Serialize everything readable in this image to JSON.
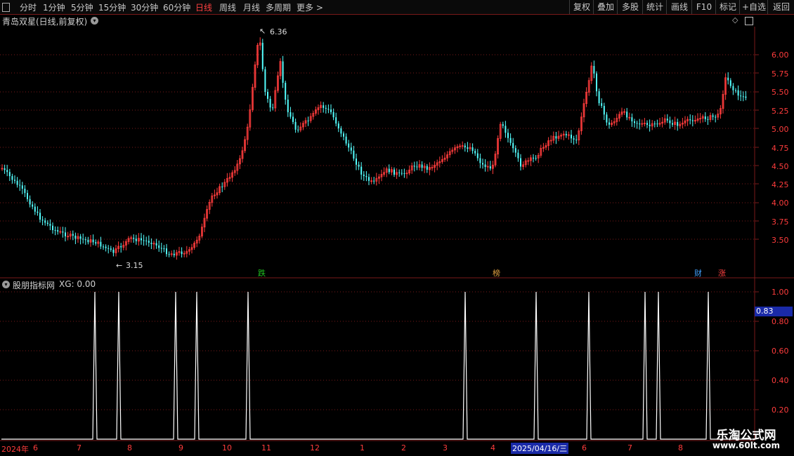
{
  "toolbar": {
    "left_items": [
      "分时",
      "1分钟",
      "5分钟",
      "15分钟",
      "30分钟",
      "60分钟",
      "日线",
      "周线",
      "月线",
      "多周期",
      "更多 >"
    ],
    "active": "日线",
    "right_items": [
      "复权",
      "叠加",
      "多股",
      "统计",
      "画线",
      "F10",
      "标记",
      "+自选",
      "返回"
    ]
  },
  "main_panel": {
    "title": "青岛双星(日线,前复权)",
    "price_ticks": [
      "6.00",
      "5.75",
      "5.50",
      "5.25",
      "5.00",
      "4.75",
      "4.50",
      "4.25",
      "4.00",
      "3.75",
      "3.50"
    ],
    "high_label": "6.36",
    "low_label": "3.15",
    "markers": [
      {
        "text": "跌",
        "color": "#20c020"
      },
      {
        "text": "榜",
        "color": "#e0a040"
      },
      {
        "text": "财",
        "color": "#40a0ff"
      },
      {
        "text": "涨",
        "color": "#ff4040"
      }
    ]
  },
  "indicator_panel": {
    "title": "股朋指标网",
    "value_label": "XG: 0.00",
    "ticks": [
      "1.00",
      "0.80",
      "0.60",
      "0.40",
      "0.20"
    ],
    "cursor_value": "0.83"
  },
  "date_axis": {
    "labels": [
      "2024年",
      "6",
      "7",
      "8",
      "9",
      "10",
      "11",
      "12",
      "1",
      "2",
      "3",
      "4",
      "2025/04/16/三",
      "6",
      "7",
      "8"
    ]
  },
  "watermark": {
    "line1": "乐淘公式网",
    "line2": "www.60lt.com"
  },
  "colors": {
    "up": "#ff3c3c",
    "down": "#54ffff",
    "grid": "#7a1a1a",
    "signal": "#ffffff"
  }
}
